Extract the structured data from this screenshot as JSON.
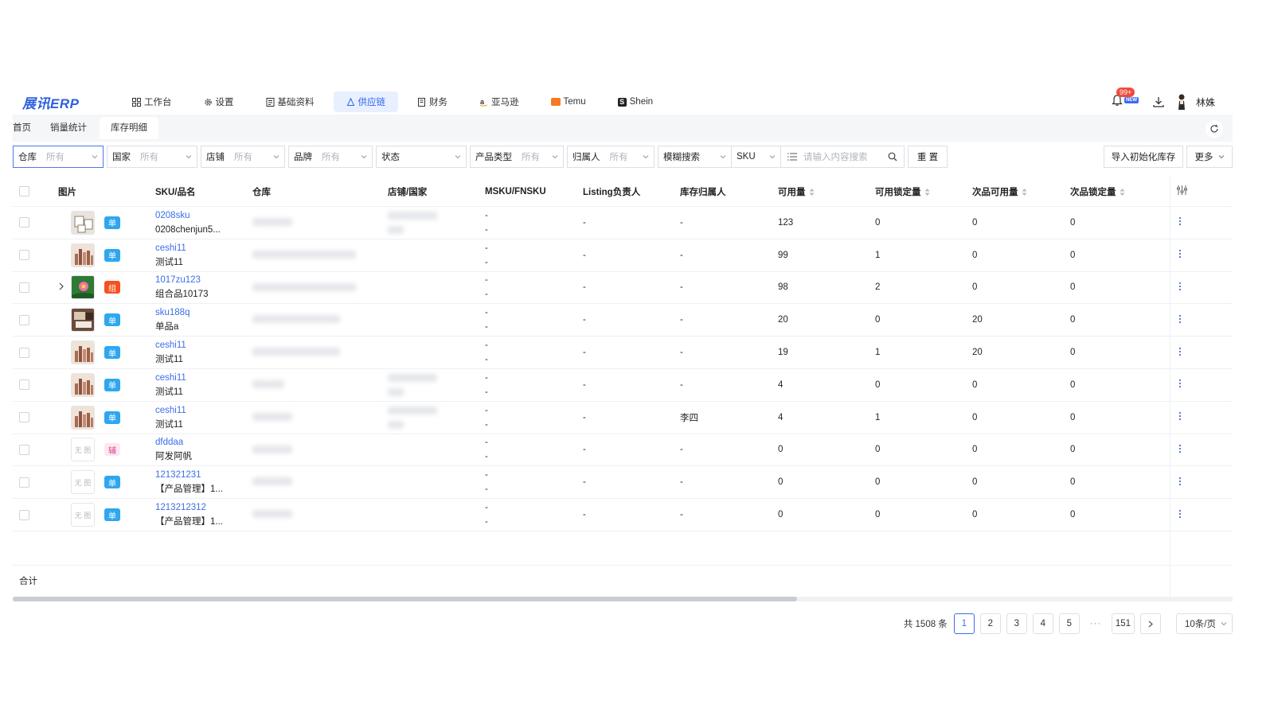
{
  "app": {
    "logo": "展讯ERP",
    "username": "林姝",
    "notif_badge": "99+",
    "new_label": "NEW"
  },
  "nav": [
    {
      "label": "工作台",
      "icon": "grid-icon"
    },
    {
      "label": "设置",
      "icon": "gear-icon"
    },
    {
      "label": "基础资料",
      "icon": "document-icon"
    },
    {
      "label": "供应链",
      "icon": "supply-chain-icon",
      "active": true
    },
    {
      "label": "财务",
      "icon": "ledger-icon"
    },
    {
      "label": "亚马逊",
      "icon": "amazon-icon"
    },
    {
      "label": "Temu",
      "icon": "temu-icon"
    },
    {
      "label": "Shein",
      "icon": "shein-icon"
    }
  ],
  "tabs": [
    {
      "label": "首页"
    },
    {
      "label": "销量统计"
    },
    {
      "label": "库存明细",
      "active": true
    }
  ],
  "filters": {
    "warehouse": {
      "label": "仓库",
      "value": "所有"
    },
    "country": {
      "label": "国家",
      "value": "所有"
    },
    "store": {
      "label": "店铺",
      "value": "所有"
    },
    "brand": {
      "label": "品牌",
      "value": "所有"
    },
    "status": {
      "label": "状态",
      "value": ""
    },
    "product_type": {
      "label": "产品类型",
      "value": "所有"
    },
    "owner": {
      "label": "归属人",
      "value": "所有"
    },
    "fuzzy": {
      "label": "模糊搜索"
    },
    "field": {
      "label": "SKU"
    },
    "search_placeholder": "请输入内容搜索",
    "reset": "重 置",
    "import": "导入初始化库存",
    "more": "更多"
  },
  "columns": [
    "图片",
    "SKU/品名",
    "仓库",
    "店铺/国家",
    "MSKU/FNSKU",
    "Listing负责人",
    "库存归属人",
    "可用量",
    "可用锁定量",
    "次品可用量",
    "次品锁定量"
  ],
  "rows": [
    {
      "img": "frames",
      "tag": "单",
      "code": "0208sku",
      "name": "0208chenjun5...",
      "msku1": "-",
      "msku2": "-",
      "listing": "-",
      "owner": "-",
      "avail": "123",
      "locked": "0",
      "def_avail": "0",
      "def_locked": "0",
      "expand": false
    },
    {
      "img": "cosmetics",
      "tag": "单",
      "code": "ceshi11",
      "name": "测试11",
      "msku1": "-",
      "msku2": "-",
      "listing": "-",
      "owner": "-",
      "avail": "99",
      "locked": "1",
      "def_avail": "0",
      "def_locked": "0",
      "expand": false
    },
    {
      "img": "flower",
      "tag": "组",
      "code": "1017zu123",
      "name": "组合品10173",
      "msku1": "-",
      "msku2": "-",
      "listing": "-",
      "owner": "-",
      "avail": "98",
      "locked": "2",
      "def_avail": "0",
      "def_locked": "0",
      "expand": true
    },
    {
      "img": "room",
      "tag": "单",
      "code": "sku188q",
      "name": "单品a",
      "msku1": "-",
      "msku2": "-",
      "listing": "-",
      "owner": "-",
      "avail": "20",
      "locked": "0",
      "def_avail": "20",
      "def_locked": "0",
      "expand": false
    },
    {
      "img": "cosmetics",
      "tag": "单",
      "code": "ceshi11",
      "name": "测试11",
      "msku1": "-",
      "msku2": "-",
      "listing": "-",
      "owner": "-",
      "avail": "19",
      "locked": "1",
      "def_avail": "20",
      "def_locked": "0",
      "expand": false
    },
    {
      "img": "cosmetics",
      "tag": "单",
      "code": "ceshi11",
      "name": "测试11",
      "msku1": "-",
      "msku2": "-",
      "listing": "-",
      "owner": "-",
      "avail": "4",
      "locked": "0",
      "def_avail": "0",
      "def_locked": "0",
      "expand": false
    },
    {
      "img": "cosmetics",
      "tag": "单",
      "code": "ceshi11",
      "name": "测试11",
      "msku1": "-",
      "msku2": "-",
      "listing": "-",
      "owner": "李四",
      "avail": "4",
      "locked": "1",
      "def_avail": "0",
      "def_locked": "0",
      "expand": false
    },
    {
      "img": "none",
      "tag": "辅",
      "code": "dfddaa",
      "name": "阿发阿帆",
      "msku1": "-",
      "msku2": "-",
      "listing": "-",
      "owner": "-",
      "avail": "0",
      "locked": "0",
      "def_avail": "0",
      "def_locked": "0",
      "expand": false
    },
    {
      "img": "none",
      "tag": "单",
      "code": "121321231",
      "name": "【产品管理】1...",
      "msku1": "-",
      "msku2": "-",
      "listing": "-",
      "owner": "-",
      "avail": "0",
      "locked": "0",
      "def_avail": "0",
      "def_locked": "0",
      "expand": false
    },
    {
      "img": "none",
      "tag": "单",
      "code": "1213212312",
      "name": "【产品管理】1...",
      "msku1": "-",
      "msku2": "-",
      "listing": "-",
      "owner": "-",
      "avail": "0",
      "locked": "0",
      "def_avail": "0",
      "def_locked": "0",
      "expand": false
    }
  ],
  "no_image_label": "无 图",
  "total_label": "合计",
  "pagination": {
    "total": "共 1508 条",
    "pages": [
      "1",
      "2",
      "3",
      "4",
      "5"
    ],
    "ellipsis": "···",
    "last": "151",
    "page_size": "10条/页",
    "current": "1"
  },
  "colors": {
    "accent": "#3b6ee8",
    "tag_single": "#2ea7f0",
    "tag_combo": "#f5511e",
    "tag_aux_bg": "#fde8f1",
    "tag_aux_text": "#e0408a"
  }
}
